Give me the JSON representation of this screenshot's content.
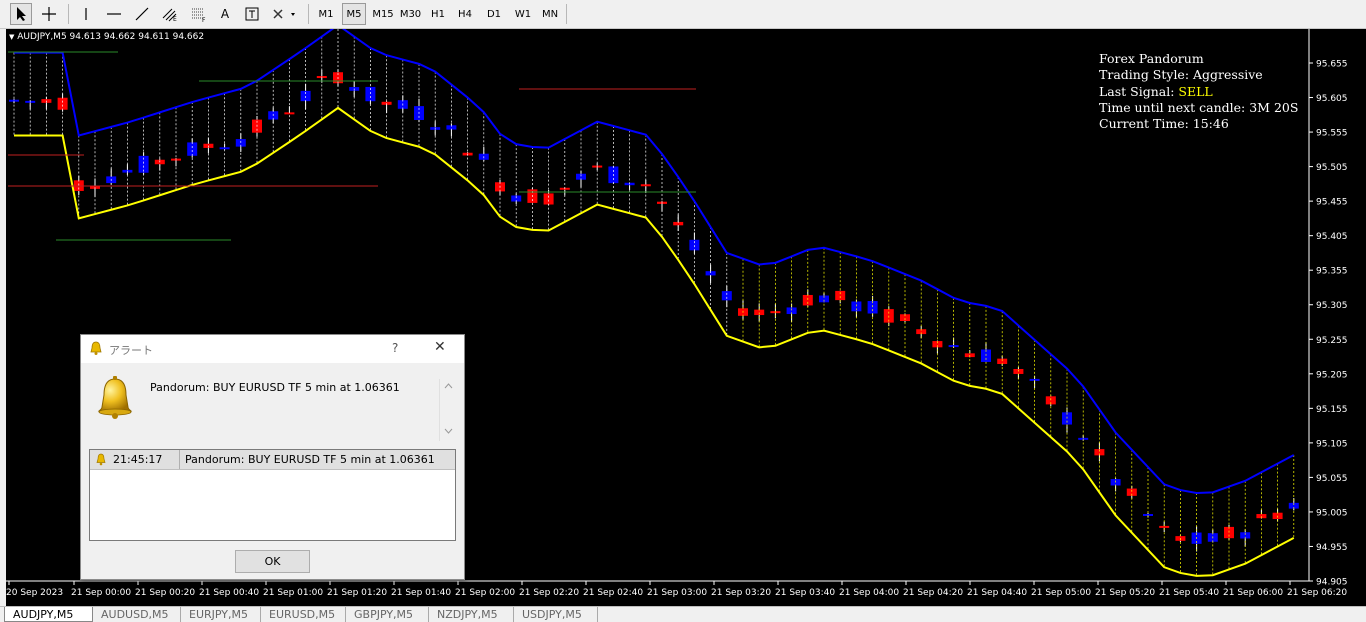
{
  "toolbar": {
    "timeframes": [
      "M1",
      "M5",
      "M15",
      "M30",
      "H1",
      "H4",
      "D1",
      "W1",
      "MN"
    ],
    "active": "M5"
  },
  "chart": {
    "symbol_header": "AUDJPY,M5  94.613 94.662 94.611 94.662",
    "price_axis": [
      "95.655",
      "95.605",
      "95.555",
      "95.505",
      "95.455",
      "95.405",
      "95.355",
      "95.305",
      "95.255",
      "95.205",
      "95.155",
      "95.105",
      "95.055",
      "95.005",
      "94.955",
      "94.905"
    ],
    "time_axis": [
      "20 Sep 2023",
      "21 Sep 00:00",
      "21 Sep 00:20",
      "21 Sep 00:40",
      "21 Sep 01:00",
      "21 Sep 01:20",
      "21 Sep 01:40",
      "21 Sep 02:00",
      "21 Sep 02:20",
      "21 Sep 02:40",
      "21 Sep 03:00",
      "21 Sep 03:20",
      "21 Sep 03:40",
      "21 Sep 04:00",
      "21 Sep 04:20",
      "21 Sep 04:40",
      "21 Sep 05:00",
      "21 Sep 05:20",
      "21 Sep 05:40",
      "21 Sep 06:00",
      "21 Sep 06:20"
    ],
    "colors": {
      "background": "#000000",
      "bull": "#0000ff",
      "bear": "#ff0000",
      "upper_band": "#0000ff",
      "lower_band": "#ffff00",
      "text": "#ffffff"
    }
  },
  "info_panel": {
    "title": "Forex Pandorum",
    "style": "Trading Style: Aggressive",
    "signal_label": "Last Signal: ",
    "signal_value": "SELL",
    "countdown": "Time until next candle: 3M 20S",
    "current_time": "Current Time: 15:46"
  },
  "alert": {
    "title": "アラート",
    "help": "?",
    "close": "✕",
    "message": "Pandorum: BUY EURUSD TF 5 min at 1.06361",
    "rows": [
      {
        "time": "21:45:17",
        "message": "Pandorum: BUY EURUSD TF 5 min at 1.06361"
      }
    ],
    "ok_label": "OK"
  },
  "tabs": [
    "AUDJPY,M5",
    "AUDUSD,M5",
    "EURJPY,M5",
    "EURUSD,M5",
    "GBPJPY,M5",
    "NZDJPY,M5",
    "USDJPY,M5"
  ],
  "tab_active": 0
}
